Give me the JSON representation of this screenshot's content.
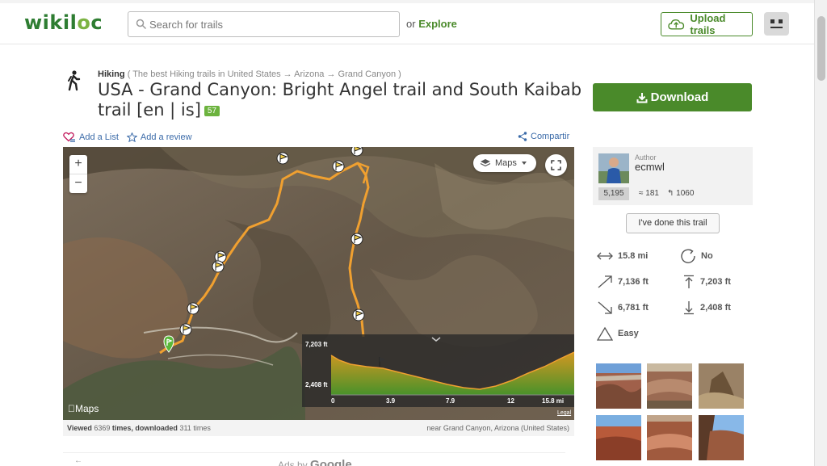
{
  "header": {
    "logo": "wikiloc",
    "search_placeholder": "Search for trails",
    "or_text": "or",
    "explore_label": "Explore",
    "upload_label": "Upload trails"
  },
  "trail": {
    "activity": "Hiking",
    "breadcrumb": "( The best Hiking trails in United States → Arizona → Grand Canyon )",
    "title": "USA - Grand Canyon: Bright Angel trail and South Kaibab trail [en | is]",
    "badge": "57",
    "download_label": "Download",
    "add_to_list": "Add a List",
    "add_review": "Add a review",
    "share": "Compartir"
  },
  "map": {
    "maps_label": "Maps",
    "zoom_in": "+",
    "zoom_out": "−",
    "attribution": "Maps",
    "legal": "Legal",
    "profile": {
      "y_top": "7,203 ft",
      "y_bottom": "2,408 ft",
      "x_ticks": [
        "0",
        "3.9",
        "7.9",
        "12",
        "15.8 mi"
      ]
    },
    "footer": {
      "viewed_label": "Viewed",
      "viewed_count": "6369",
      "times_downloaded": "times, downloaded",
      "downloaded_count": "311",
      "times": "times",
      "location": "near Grand Canyon, Arizona (United States)"
    }
  },
  "ads": {
    "prefix": "Ads by",
    "brand": "Google"
  },
  "author": {
    "label": "Author",
    "name": "ecmwl",
    "points": "5,195",
    "trails": "181",
    "followers": "1060",
    "done_label": "I've done this trail"
  },
  "stats": {
    "distance": "15.8 mi",
    "loop": "No",
    "elev_gain": "7,136 ft",
    "max_elev": "7,203 ft",
    "elev_loss": "6,781 ft",
    "min_elev": "2,408 ft",
    "difficulty": "Easy"
  },
  "colors": {
    "brand_green": "#4a8a2a",
    "track_orange": "#f0a030",
    "link_blue": "#3a6aa8"
  }
}
